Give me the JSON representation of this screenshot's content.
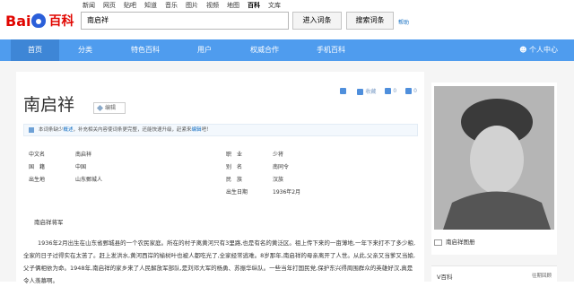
{
  "header": {
    "logo_bai": "Bai",
    "logo_baike": "百科",
    "top_links": [
      "新闻",
      "网页",
      "贴吧",
      "知道",
      "音乐",
      "图片",
      "视频",
      "地图",
      "百科",
      "文库"
    ],
    "search_value": "南启祥",
    "enter_button": "进入词条",
    "search_button": "搜索词条",
    "help": "帮助"
  },
  "nav": {
    "items": [
      "首页",
      "分类",
      "特色百科",
      "用户",
      "权威合作",
      "手机百科"
    ],
    "user": "个人中心"
  },
  "entry": {
    "title": "南启祥",
    "edit": "编辑",
    "actions": [
      "收藏",
      "0",
      "0"
    ],
    "notice_text": "本词条缺少",
    "notice_link1": "概述",
    "notice_mid": "，补充相关内容使词条更完整，还能快速升级，赶紧来",
    "notice_link2": "编辑",
    "notice_end": "吧！"
  },
  "basic_info": [
    {
      "label": "中文名",
      "value": "南启祥"
    },
    {
      "label": "职　业",
      "value": "少将"
    },
    {
      "label": "国　籍",
      "value": "中国"
    },
    {
      "label": "别　名",
      "value": "南同令"
    },
    {
      "label": "出生地",
      "value": "山东鄄城人"
    },
    {
      "label": "民　族",
      "value": "汉族"
    },
    {
      "label": "出生日期",
      "value": "1936年2月"
    }
  ],
  "subtitle": "南启祥将军",
  "paragraph": "1936年2月出生在山东省鄄城县的一个农民家庭。所在的村子离黄河只有3里路,也是有名的黄泛区。祖上传下来的一亩薄地,一年下来打不了多少粮,全家的日子过得实在太苦了。赶上发洪水,黄河西岸的榆树叶也被人都吃光了,全家经常逃难。8岁那年,南启祥的母亲离开了人世。从此,父亲又当爹又当娘,父子俩相依为命。1948年,南启祥的家乡来了人民解放军部队,是刘邓大军的杨勇、苏振华纵队。一些当年打国民党,保护东兴得周围群众的英雄好汉,真是令人羡慕啊。",
  "side": {
    "caption": "南启祥图册",
    "vbaike": "V百科",
    "vbaike_more": "往期回顾"
  },
  "colors": {
    "nav_bg": "#4f9cee",
    "logo_red": "#e10601",
    "link": "#136ec2"
  }
}
